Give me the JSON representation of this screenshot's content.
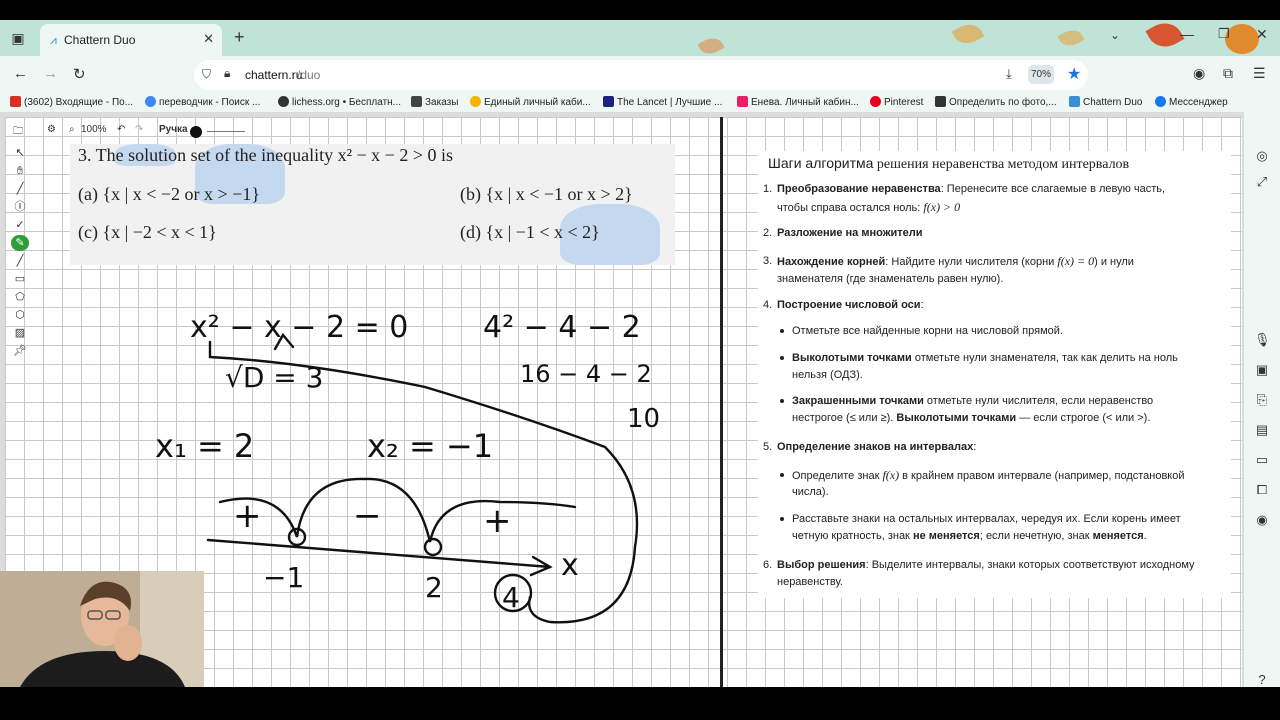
{
  "browser": {
    "tab_title": "Chattern Duo",
    "url_host": "chattern.ru",
    "url_path": "/duo",
    "zoom": "70%",
    "bookmarks": [
      {
        "label": "(3602) Входящие - По...",
        "color": "#d93025"
      },
      {
        "label": "переводчик - Поиск ...",
        "color": "#4285f4"
      },
      {
        "label": "lichess.org • Бесплатн...",
        "color": "#333333"
      },
      {
        "label": "Заказы",
        "color": "#444444"
      },
      {
        "label": "Единый личный каби...",
        "color": "#f4b400"
      },
      {
        "label": "The Lancet | Лучшие ...",
        "color": "#1a237e"
      },
      {
        "label": "Енева. Личный кабин...",
        "color": "#e91e63"
      },
      {
        "label": "Pinterest",
        "color": "#e60023"
      },
      {
        "label": "Определить по фото,...",
        "color": "#333333"
      },
      {
        "label": "Chattern Duo",
        "color": "#3a8fd0"
      },
      {
        "label": "Мессенджер",
        "color": "#1877f2"
      }
    ]
  },
  "board": {
    "zoom_label": "100%",
    "pen_label": "Ручка",
    "question": {
      "stem": "3. The solution set of the inequality x² − x − 2 > 0 is",
      "a": "(a) {x | x < −2 or x > −1}",
      "b": "(b) {x | x < −1 or x > 2}",
      "c": "(c) {x | −2 < x < 1}",
      "d": "(d) {x | −1 < x < 2}"
    },
    "handwriting": {
      "eq": "x² − x − 2 = 0",
      "disc": "√D = 3",
      "check1": "4² − 4 − 2",
      "check2": "16 − 4 − 2",
      "check3": "10",
      "root1": "x₁ = 2",
      "root2": "x₂ = −1",
      "plus1": "+",
      "minus": "−",
      "plus2": "+",
      "axis": "x",
      "pt1": "−1",
      "pt2": "2",
      "pt3": "4"
    }
  },
  "notes": {
    "title_bold": "Шаги алгоритма",
    "title_rest": " решения неравенства методом интервалов",
    "s1_bold": "Преобразование неравенства",
    "s1_text": ": Перенесите все слагаемые в левую часть,",
    "s1_text2": "чтобы справа остался ноль: ",
    "s1_formula": "f(x) > 0",
    "s2_bold": "Разложение на множители",
    "s3_bold": "Нахождение корней",
    "s3_text": ": Найдите нули числителя (корни ",
    "s3_formula": "f(x) = 0",
    "s3_text2": ") и нули",
    "s3_text3": "знаменателя (где знаменатель равен нулю).",
    "s4_bold": "Построение числовой оси",
    "b1": "Отметьте все найденные корни на числовой прямой.",
    "b2_bold": "Выколотыми точками",
    "b2_text": " отметьте нули знаменателя, так как делить на ноль",
    "b2_text2": "нельзя (ОДЗ).",
    "b3_bold": "Закрашенными точками",
    "b3_text": " отметьте нули числителя, если неравенство",
    "b3_text2a": "нестрогое (≤ или ≥). ",
    "b3_bold2": "Выколотыми точками",
    "b3_text2b": " — если строгое (< или >).",
    "s5_bold": "Определение знаков на интервалах",
    "b4_text": "Определите знак ",
    "b4_formula": "f(x)",
    "b4_text2": " в крайнем правом интервале (например, подстановкой",
    "b4_text3": "числа).",
    "b5_text": "Расставьте знаки на остальных интервалах, чередуя их. Если корень имеет",
    "b5_text2a": "четную кратность, знак ",
    "b5_bold": "не меняется",
    "b5_text2b": "; если нечетную, знак ",
    "b5_bold2": "меняется",
    "b5_text2c": ".",
    "s6_bold": "Выбор решения",
    "s6_text": ": Выделите интервалы, знаки которых соответствуют исходному",
    "s6_text2": "неравенству."
  },
  "colors": {
    "tabstrip": "#bfe3d7",
    "toolbar": "#eef7f3",
    "highlight": "#bcd3ee",
    "accent": "#1a73e8"
  }
}
